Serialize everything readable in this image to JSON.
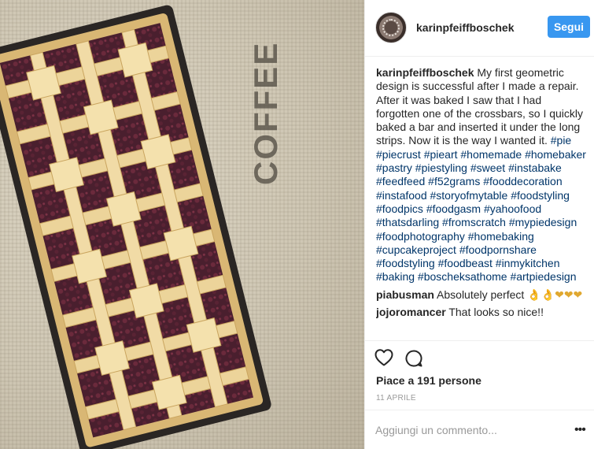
{
  "post": {
    "image_alt_word": "COFFEE",
    "username": "karinpfeiffboschek",
    "follow_label": "Segui",
    "caption_user": "karinpfeiffboschek",
    "caption_text": "My first geometric design is successful after I made a repair. After it was baked I saw that I had forgotten one of the crossbars, so I quickly baked a bar and inserted it under the long strips. Now it is the way I wanted it.",
    "hashtags": "#pie #piecrust #pieart #homemade #homebaker #pastry #piestyling #sweet #instabake #feedfeed #f52grams #fooddecoration #instafood #storyofmytable #foodstyling #foodpics #foodgasm #yahoofood #thatsdarling #fromscratch #mypiedesign #foodphotography #homebaking #cupcakeproject #foodpornshare #foodstyling #foodbeast #inmykitchen #baking #boscheksathome #artpiedesign",
    "comments": [
      {
        "user": "piabusman",
        "text": "Absolutely perfect",
        "emoji": "👌👌❤❤❤"
      },
      {
        "user": "jojoromancer",
        "text": "That looks so nice!!",
        "emoji": ""
      }
    ],
    "likes": "Piace a 191 persone",
    "date": "11 APRILE",
    "add_comment_placeholder": "Aggiungi un commento...",
    "more_label": "•••"
  },
  "icons": {
    "heart": "heart-icon",
    "comment": "comment-icon",
    "more": "more-options-icon"
  },
  "colors": {
    "follow_button": "#3897f0",
    "hashtag": "#003569",
    "secondary_text": "#999999"
  }
}
